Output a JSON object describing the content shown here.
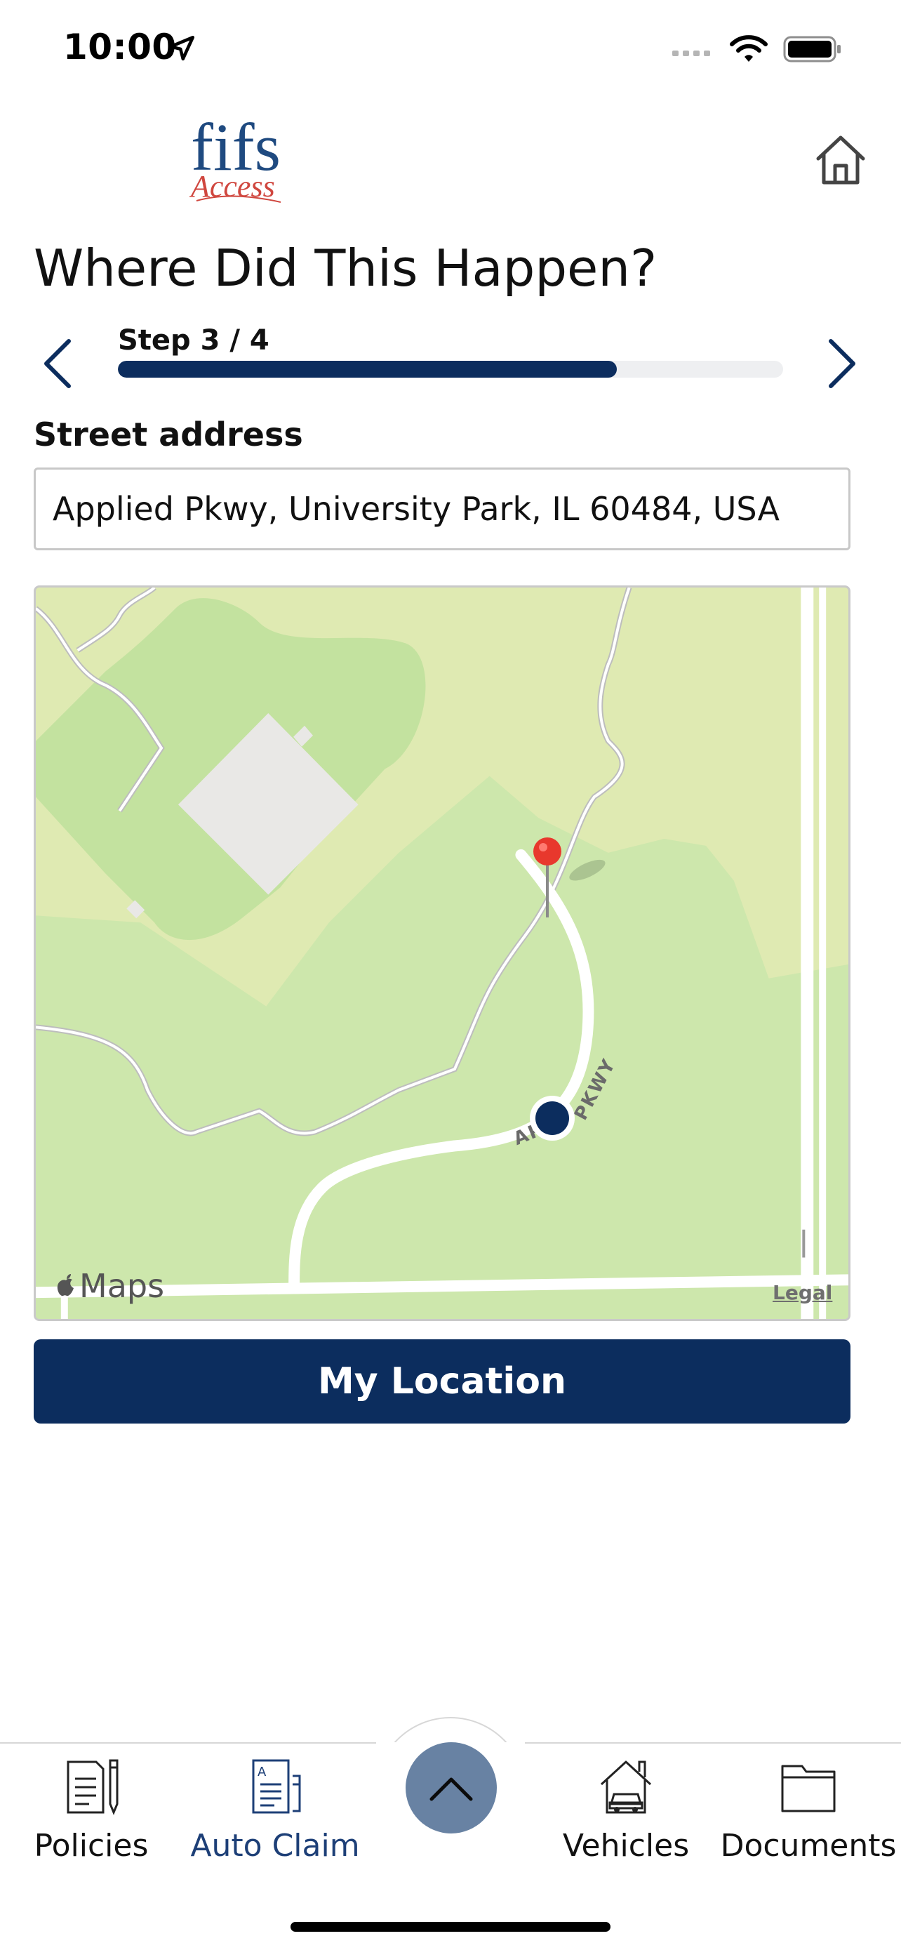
{
  "status": {
    "time": "10:00"
  },
  "header": {
    "logo_text": "fifs",
    "logo_script": "Access"
  },
  "page": {
    "title": "Where Did This Happen?"
  },
  "stepper": {
    "label": "Step 3 / 4",
    "progress": 0.75
  },
  "address": {
    "label": "Street address",
    "value": "Applied Pkwy, University Park, IL 60484, USA"
  },
  "map": {
    "brand": "Maps",
    "legal": "Legal",
    "road_label_a": "APP",
    "road_label_b": "PKWY"
  },
  "actions": {
    "my_location": "My Location"
  },
  "tabs": [
    {
      "label": "Policies",
      "icon": "document-pencil-icon"
    },
    {
      "label": "Auto Claim",
      "icon": "claim-form-icon"
    },
    {
      "label": "Vehicles",
      "icon": "house-car-icon"
    },
    {
      "label": "Documents",
      "icon": "folder-icon"
    }
  ],
  "colors": {
    "primary": "#0c2d5e",
    "fab": "#6882a3",
    "pin": "#e8382d",
    "map_bg": "#dfeab2",
    "park": "#c4e2a0"
  }
}
